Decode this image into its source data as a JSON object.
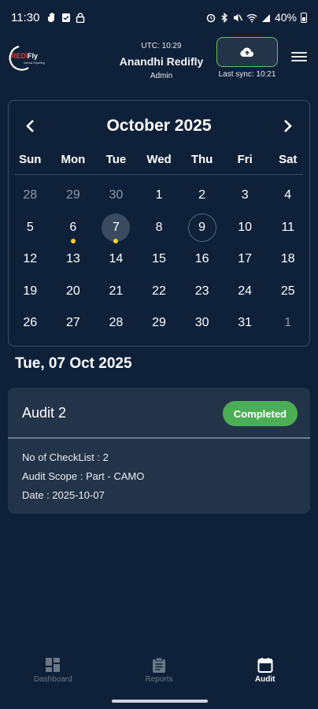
{
  "status_bar": {
    "time": "11:30",
    "battery": "40%"
  },
  "header": {
    "logo_text": "REDIFly",
    "logo_sub": "Internal Reporting",
    "utc_time": "UTC: 10:29",
    "user_name": "Anandhi Redifly",
    "user_role": "Admin",
    "last_sync": "Last sync:   10:21"
  },
  "calendar": {
    "month_title": "October 2025",
    "weekdays": [
      "Sun",
      "Mon",
      "Tue",
      "Wed",
      "Thu",
      "Fri",
      "Sat"
    ],
    "weeks": [
      [
        {
          "d": "28",
          "out": true
        },
        {
          "d": "29",
          "out": true
        },
        {
          "d": "30",
          "out": true
        },
        {
          "d": "1"
        },
        {
          "d": "2"
        },
        {
          "d": "3"
        },
        {
          "d": "4"
        }
      ],
      [
        {
          "d": "5"
        },
        {
          "d": "6",
          "dot": true
        },
        {
          "d": "7",
          "dot": true,
          "selected": true
        },
        {
          "d": "8"
        },
        {
          "d": "9",
          "today": true
        },
        {
          "d": "10"
        },
        {
          "d": "11"
        }
      ],
      [
        {
          "d": "12"
        },
        {
          "d": "13"
        },
        {
          "d": "14"
        },
        {
          "d": "15"
        },
        {
          "d": "16"
        },
        {
          "d": "17"
        },
        {
          "d": "18"
        }
      ],
      [
        {
          "d": "19"
        },
        {
          "d": "20"
        },
        {
          "d": "21"
        },
        {
          "d": "22"
        },
        {
          "d": "23"
        },
        {
          "d": "24"
        },
        {
          "d": "25"
        }
      ],
      [
        {
          "d": "26"
        },
        {
          "d": "27"
        },
        {
          "d": "28"
        },
        {
          "d": "29"
        },
        {
          "d": "30"
        },
        {
          "d": "31"
        },
        {
          "d": "1",
          "out": true
        }
      ]
    ]
  },
  "selected_date_label": "Tue, 07 Oct 2025",
  "audit": {
    "title": "Audit 2",
    "status": "Completed",
    "checklist": "No of CheckList : 2",
    "scope": "Audit Scope : Part - CAMO",
    "date": "Date : 2025-10-07"
  },
  "bottom_nav": {
    "dashboard": "Dashboard",
    "reports": "Reports",
    "audit": "Audit"
  },
  "colors": {
    "background": "#0f2139",
    "card": "#233449",
    "completed": "#4cae54",
    "event_dot": "#f4d21b",
    "sync_border": "#5fbf65"
  }
}
